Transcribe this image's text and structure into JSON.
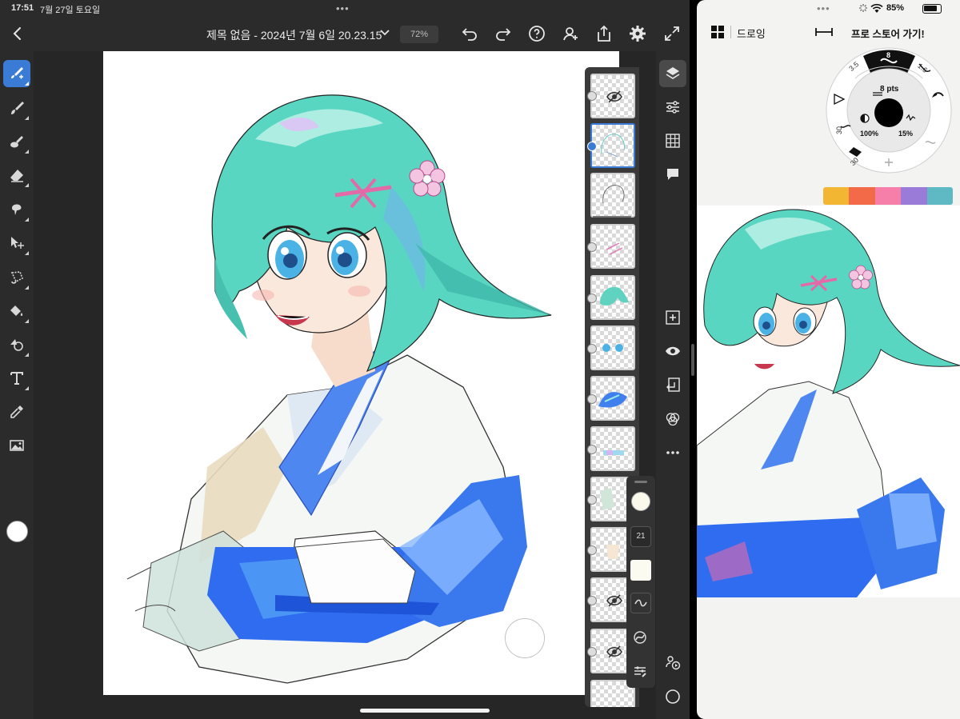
{
  "status_bar": {
    "time": "17:51",
    "date": "7월 27일 토요일",
    "battery_percent": "85%",
    "battery_level": 0.85
  },
  "left_app": {
    "document_title": "제목 없음 - 2024년 7월 6일 20.23.15",
    "zoom": "72%",
    "toolbar_icons": [
      "undo-icon",
      "redo-icon",
      "help-icon",
      "invite-icon",
      "share-icon",
      "settings-icon",
      "fullscreen-icon"
    ],
    "tools": [
      "brush-tool-icon",
      "paint-brush-icon",
      "smudge-icon",
      "eraser-icon",
      "liquify-icon",
      "move-icon",
      "lasso-icon",
      "fill-icon",
      "shape-icon",
      "text-icon",
      "eyedropper-icon",
      "image-icon"
    ],
    "active_tool": "brush-tool-icon",
    "current_color": "#ffffff",
    "brush_size": "21",
    "brush_color": "#fbf8ec",
    "accent": "#3a7bd5"
  },
  "right_app": {
    "drawing_label": "드로잉",
    "pro_store_link": "프로 스토어 가기!",
    "wheel": {
      "size": "8 pts",
      "top_value": "8",
      "opacity": "100%",
      "flow": "15%",
      "left_value": "3.5",
      "right_value": "1.6",
      "lower_value_a": "30",
      "lower_value_b": "30"
    },
    "palette": [
      "#f2b632",
      "#f26a47",
      "#f57fa9",
      "#9a7bd8",
      "#5fb9c4"
    ]
  }
}
